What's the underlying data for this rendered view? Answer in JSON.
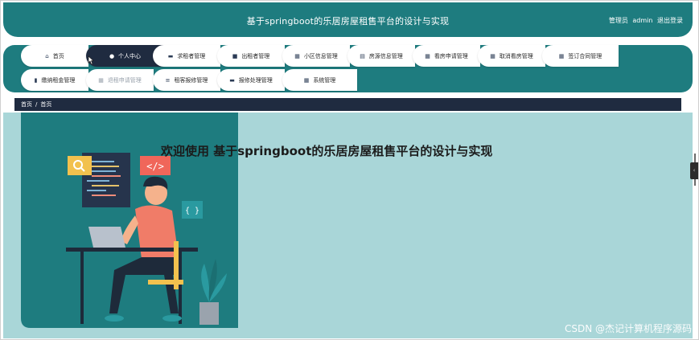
{
  "header": {
    "title": "基于springboot的乐居房屋租售平台的设计与实现",
    "role": "管理员",
    "username": "admin",
    "logout": "退出登录"
  },
  "nav": {
    "row1": [
      {
        "label": "首页",
        "icon": "home-icon"
      },
      {
        "label": "个人中心",
        "icon": "user-icon"
      },
      {
        "label": "求租者管理",
        "icon": "card-icon"
      },
      {
        "label": "出租者管理",
        "icon": "suitcase-icon"
      },
      {
        "label": "小区信息管理",
        "icon": "grid-icon"
      },
      {
        "label": "房源信息管理",
        "icon": "briefcase-icon"
      },
      {
        "label": "看房申请管理",
        "icon": "grid-icon"
      },
      {
        "label": "取消看房管理",
        "icon": "grid-icon"
      },
      {
        "label": "签订合同管理",
        "icon": "grid-icon"
      }
    ],
    "row2": [
      {
        "label": "缴纳租金管理",
        "icon": "bar-chart-icon"
      },
      {
        "label": "退租申请管理",
        "icon": "grid-icon"
      },
      {
        "label": "租客报修管理",
        "icon": "sliders-icon"
      },
      {
        "label": "报修处理管理",
        "icon": "card-icon"
      },
      {
        "label": "系统管理",
        "icon": "grid-icon"
      }
    ]
  },
  "breadcrumb": {
    "root": "首页",
    "separator": "/",
    "current": "首页"
  },
  "main": {
    "welcome": "欢迎使用 基于springboot的乐居房屋租售平台的设计与实现",
    "illustration_code_tag": "</>",
    "illustration_brace_tag": "{ }"
  },
  "watermark": "CSDN @杰记计算机程序源码",
  "colors": {
    "teal": "#1e7c7f",
    "navy": "#1f2b40",
    "content_bg": "#a9d6d8"
  }
}
